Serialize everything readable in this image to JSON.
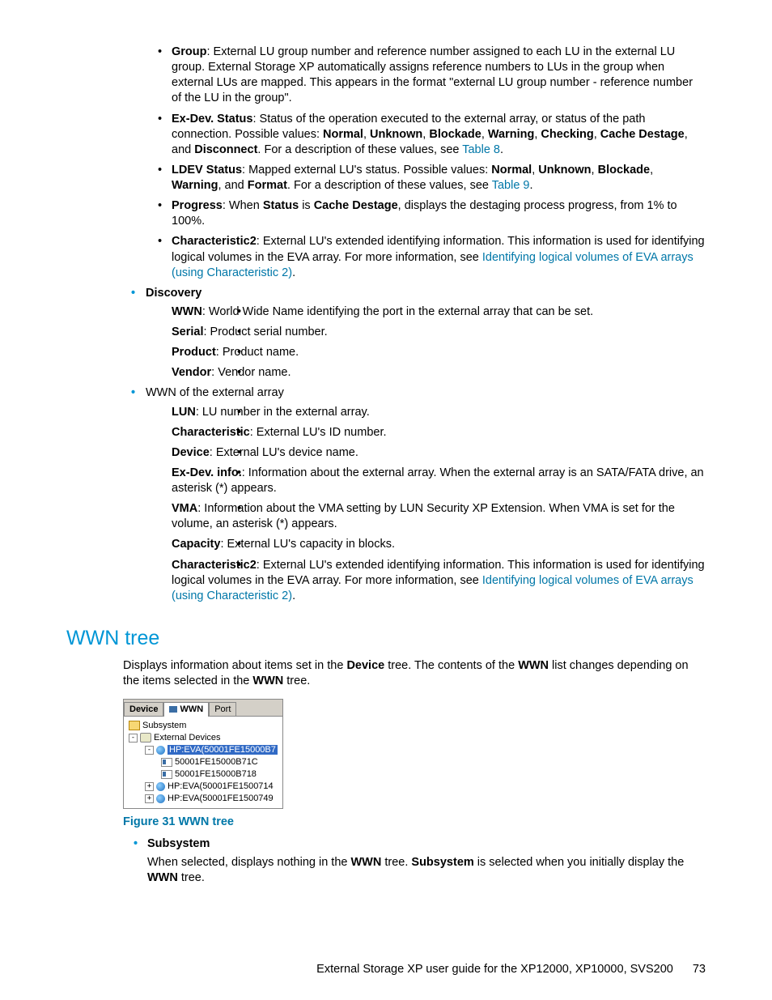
{
  "bullets_top": [
    {
      "term": "Group",
      "text": ": External LU group number and reference number assigned to each LU in the external LU group. External Storage XP automatically assigns reference numbers to LUs in the group when external LUs are mapped. This appears in the format \"external LU group number - reference number of the LU in the group\"."
    },
    {
      "term": "Ex-Dev. Status",
      "text_before": ": Status of the operation executed to the external array, or status of the path connection. Possible values: ",
      "values": [
        "Normal",
        "Unknown",
        "Blockade",
        "Warning",
        "Checking",
        "Cache Destage"
      ],
      "text_mid": ", and ",
      "last_value": "Disconnect",
      "text_after": ". For a description of these values, see ",
      "link": "Table 8",
      "tail": "."
    },
    {
      "term": "LDEV Status",
      "text_before": ": Mapped external LU's status. Possible values: ",
      "values": [
        "Normal",
        "Unknown",
        "Blockade",
        "Warning"
      ],
      "text_mid": ", and ",
      "last_value": "Format",
      "text_after": ". For a description of these values, see ",
      "link": "Table 9",
      "tail": "."
    },
    {
      "term": "Progress",
      "text_before": ": When ",
      "mid_terms": [
        "Status",
        "Cache Destage"
      ],
      "mid_text": " is ",
      "text_after": ", displays the destaging process progress, from 1% to 100%."
    },
    {
      "term": "Characteristic2",
      "text_before": ": External LU's extended identifying information. This information is used for identifying logical volumes in the EVA array. For more information, see ",
      "link": "Identifying logical volumes of EVA arrays (using Characteristic 2)",
      "tail": "."
    }
  ],
  "discovery": {
    "heading": "Discovery",
    "items": [
      {
        "term": "WWN",
        "text": ": World Wide Name identifying the port in the external array that can be set."
      },
      {
        "term": "Serial",
        "text": ": Product serial number."
      },
      {
        "term": "Product",
        "text": ": Product name."
      },
      {
        "term": "Vendor",
        "text": ": Vendor name."
      }
    ]
  },
  "wwn_ext": {
    "heading": "WWN of the external array",
    "items": [
      {
        "term": "LUN",
        "text": ": LU number in the external array."
      },
      {
        "term": "Characteristic",
        "text": ": External LU's ID number."
      },
      {
        "term": "Device",
        "text": ": External LU's device name."
      },
      {
        "term": "Ex-Dev. info.",
        "text": ": Information about the external array. When the external array is an SATA/FATA drive, an asterisk (*) appears."
      },
      {
        "term": "VMA",
        "text": ": Information about the VMA setting by LUN Security XP Extension. When VMA is set for the volume, an asterisk (*) appears."
      },
      {
        "term": "Capacity",
        "text": ": External LU's capacity in blocks."
      },
      {
        "term": "Characteristic2",
        "text_before": ": External LU's extended identifying information. This information is used for identifying logical volumes in the EVA array. For more information, see ",
        "link": "Identifying logical volumes of EVA arrays (using Characteristic 2)",
        "tail": "."
      }
    ]
  },
  "section_heading": "WWN tree",
  "section_para_a": "Displays information about items set in the ",
  "section_para_b": "Device",
  "section_para_c": " tree. The contents of the ",
  "section_para_d": "WWN",
  "section_para_e": " list changes depending on the items selected in the ",
  "section_para_f": "WWN",
  "section_para_g": " tree.",
  "tree": {
    "tabs": [
      "Device",
      "WWN",
      "Port"
    ],
    "root": "Subsystem",
    "ext": "External Devices",
    "nodes": [
      {
        "label": "HP:EVA(50001FE15000B7",
        "sel": true,
        "exp": "-"
      },
      {
        "label": "50001FE15000B71C",
        "leaf": true
      },
      {
        "label": "50001FE15000B718",
        "leaf": true
      },
      {
        "label": "HP:EVA(50001FE1500714",
        "exp": "+"
      },
      {
        "label": "HP:EVA(50001FE1500749",
        "exp": "+"
      }
    ]
  },
  "figure_caption": "Figure 31 WWN tree",
  "subsystem": {
    "term": "Subsystem",
    "body_a": "When selected, displays nothing in the ",
    "body_b": "WWN",
    "body_c": " tree. ",
    "body_d": "Subsystem",
    "body_e": " is selected when you initially display the ",
    "body_f": "WWN",
    "body_g": " tree."
  },
  "footer_text": "External Storage XP user guide for the XP12000, XP10000, SVS200",
  "page_number": "73"
}
